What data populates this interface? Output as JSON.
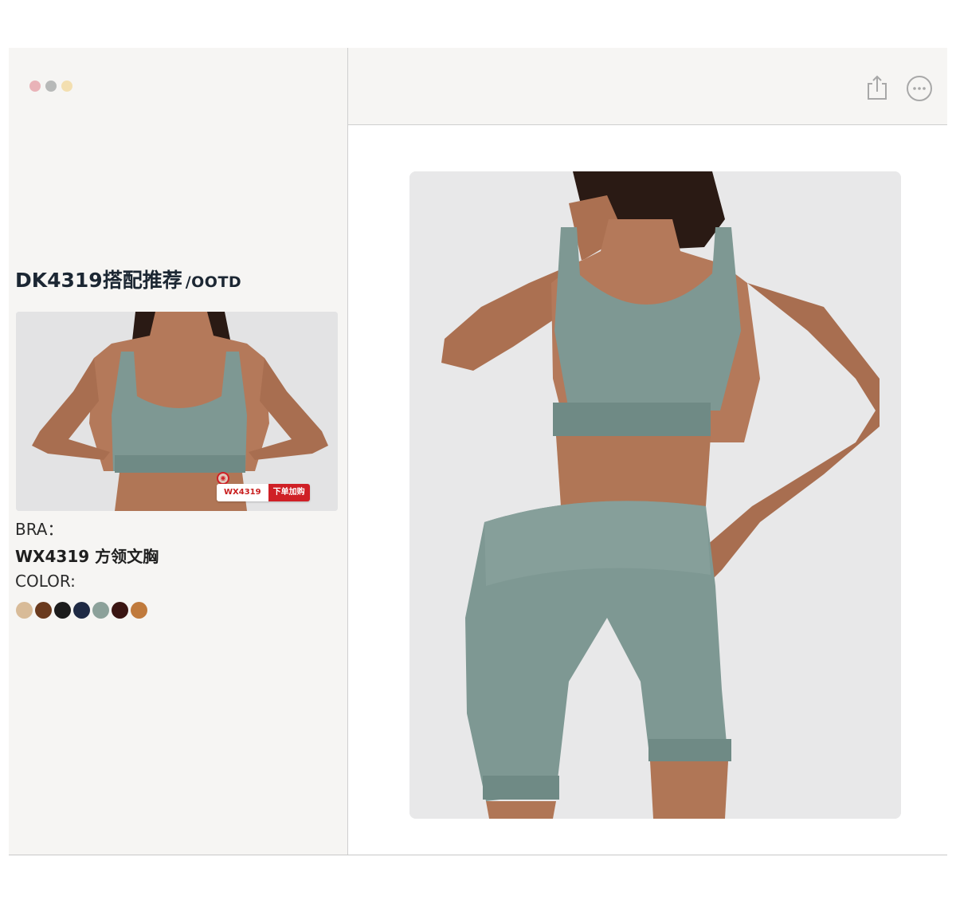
{
  "window_controls": {
    "colors": [
      "#e9b3b8",
      "#b7b9b8",
      "#f3dfb0"
    ]
  },
  "header": {
    "share_icon": "share-icon",
    "more_icon": "more-icon"
  },
  "page": {
    "title": "DK4319搭配推荐",
    "title_suffix": "/OOTD"
  },
  "thumbnail": {
    "tag_code": "WX4319",
    "tag_action": "下单加购"
  },
  "product": {
    "category_label": "BRA：",
    "name": "WX4319 方领文胸",
    "color_label": "COLOR:",
    "colors": [
      "#d8bb98",
      "#6a3a1e",
      "#1c1c1c",
      "#1f2a44",
      "#8ca19a",
      "#3a1512",
      "#c07a3c"
    ]
  },
  "theme": {
    "garment_color": "#7e9893",
    "skin_color": "#b4795a",
    "hair_color": "#2a1a14",
    "accent_red": "#cf2026"
  }
}
